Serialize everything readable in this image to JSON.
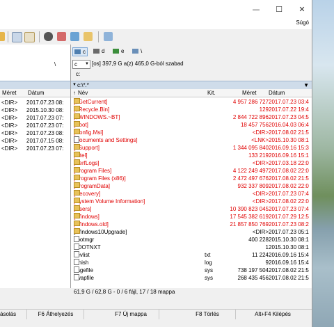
{
  "window": {
    "help_menu": "Súgó"
  },
  "left_panel": {
    "path_fragment": "\\",
    "col_size": "Méret",
    "col_date": "Dátum",
    "rows": [
      {
        "size": "<DIR>",
        "date": "2017.07.23 08:"
      },
      {
        "size": "<DIR>",
        "date": "2015.10.30 08:"
      },
      {
        "size": "<DIR>",
        "date": "2017.07.23 07:"
      },
      {
        "size": "<DIR>",
        "date": "2017.07.23 07:"
      },
      {
        "size": "<DIR>",
        "date": "2017.07.23 08:"
      },
      {
        "size": "<DIR>",
        "date": "2017.07.15 08:"
      },
      {
        "size": "<DIR>",
        "date": "2017.07.23 07:"
      }
    ]
  },
  "right_panel": {
    "drives": [
      "c",
      "d",
      "e",
      "\\"
    ],
    "drive_select": "c",
    "drive_info": "[os]  397,9 G a(z) 465,0 G-ból szabad",
    "current_path_label": "c:",
    "tab": "c:\\*.*",
    "col_name": "Név",
    "col_ext": "Kit.",
    "col_size": "Méret",
    "col_date": "Dátum",
    "files": [
      {
        "name": "[$GetCurrent]",
        "ext": "",
        "size": "4 957 286 727",
        "date": "2017.07.23 03:4",
        "red": true,
        "type": "folder"
      },
      {
        "name": "[$Recycle.Bin]",
        "ext": "",
        "size": "129",
        "date": "2017.07.22 19:4",
        "red": true,
        "type": "folder"
      },
      {
        "name": "[$WINDOWS.~BT]",
        "ext": "",
        "size": "2 844 722 896",
        "date": "2017.07.23 04:5",
        "red": true,
        "type": "folder"
      },
      {
        "name": "[Boot]",
        "ext": "",
        "size": "18 457 756",
        "date": "2016.04.03 06:4",
        "red": true,
        "type": "folder"
      },
      {
        "name": "[Config.Msi]",
        "ext": "",
        "size": "<DIR>",
        "date": "2017.08.02 21:5",
        "red": true,
        "type": "folder"
      },
      {
        "name": "[Documents and Settings]",
        "ext": "",
        "size": "<LNK>",
        "date": "2015.10.30 08:1",
        "red": true,
        "type": "link"
      },
      {
        "name": "[eSupport]",
        "ext": "",
        "size": "1 344 095 840",
        "date": "2016.09.16 15:3",
        "red": true,
        "type": "folder"
      },
      {
        "name": "[Intel]",
        "ext": "",
        "size": "133 219",
        "date": "2016.09.16 15:1",
        "red": true,
        "type": "folder"
      },
      {
        "name": "[PerfLogs]",
        "ext": "",
        "size": "<DIR>",
        "date": "2017.03.18 22:0",
        "red": true,
        "type": "folder"
      },
      {
        "name": "[Program Files]",
        "ext": "",
        "size": "4 122 249 497",
        "date": "2017.08.02 22:0",
        "red": true,
        "type": "folder"
      },
      {
        "name": "[Program Files (x86)]",
        "ext": "",
        "size": "2 472 497 676",
        "date": "2017.08.02 21:5",
        "red": true,
        "type": "folder"
      },
      {
        "name": "[ProgramData]",
        "ext": "",
        "size": "932 337 809",
        "date": "2017.08.02 22:0",
        "red": true,
        "type": "folder"
      },
      {
        "name": "[Recovery]",
        "ext": "",
        "size": "<DIR>",
        "date": "2017.07.23 07:4",
        "red": true,
        "type": "folder"
      },
      {
        "name": "[System Volume Information]",
        "ext": "",
        "size": "<DIR>",
        "date": "2017.08.02 22:0",
        "red": true,
        "type": "folder"
      },
      {
        "name": "[Users]",
        "ext": "",
        "size": "10 390 823 045",
        "date": "2017.07.23 07:4",
        "red": true,
        "type": "folder"
      },
      {
        "name": "[Windows]",
        "ext": "",
        "size": "17 545 382 619",
        "date": "2017.07.29 12:5",
        "red": true,
        "type": "folder"
      },
      {
        "name": "[Windows.old]",
        "ext": "",
        "size": "21 857 850 769",
        "date": "2017.07.23 08:2",
        "red": true,
        "type": "folder"
      },
      {
        "name": "[Windows10Upgrade]",
        "ext": "",
        "size": "<DIR>",
        "date": "2017.07.23 05:1",
        "red": false,
        "type": "folder"
      },
      {
        "name": "bootmgr",
        "ext": "",
        "size": "400 228",
        "date": "2015.10.30 08:1",
        "red": false,
        "type": "file"
      },
      {
        "name": "BOOTNXT",
        "ext": "",
        "size": "1",
        "date": "2015.10.30 08:1",
        "red": false,
        "type": "file"
      },
      {
        "name": "devlist",
        "ext": "txt",
        "size": "11 224",
        "date": "2016.09.16 15:4",
        "red": false,
        "type": "file"
      },
      {
        "name": "Finish",
        "ext": "log",
        "size": "9",
        "date": "2016.09.16 15:4",
        "red": false,
        "type": "file"
      },
      {
        "name": "pagefile",
        "ext": "sys",
        "size": "738 197 504",
        "date": "2017.08.02 21:5",
        "red": false,
        "type": "file"
      },
      {
        "name": "swapfile",
        "ext": "sys",
        "size": "268 435 456",
        "date": "2017.08.02 21:5",
        "red": false,
        "type": "file"
      }
    ]
  },
  "status": "61,9 G / 62,8 G - 0 / 6 fájl, 17 / 18 mappa",
  "function_keys": [
    "ásolás",
    "F6 Áthelyezés",
    "F7 Új mappa",
    "F8 Törlés",
    "Alt+F4 Kilépés"
  ]
}
